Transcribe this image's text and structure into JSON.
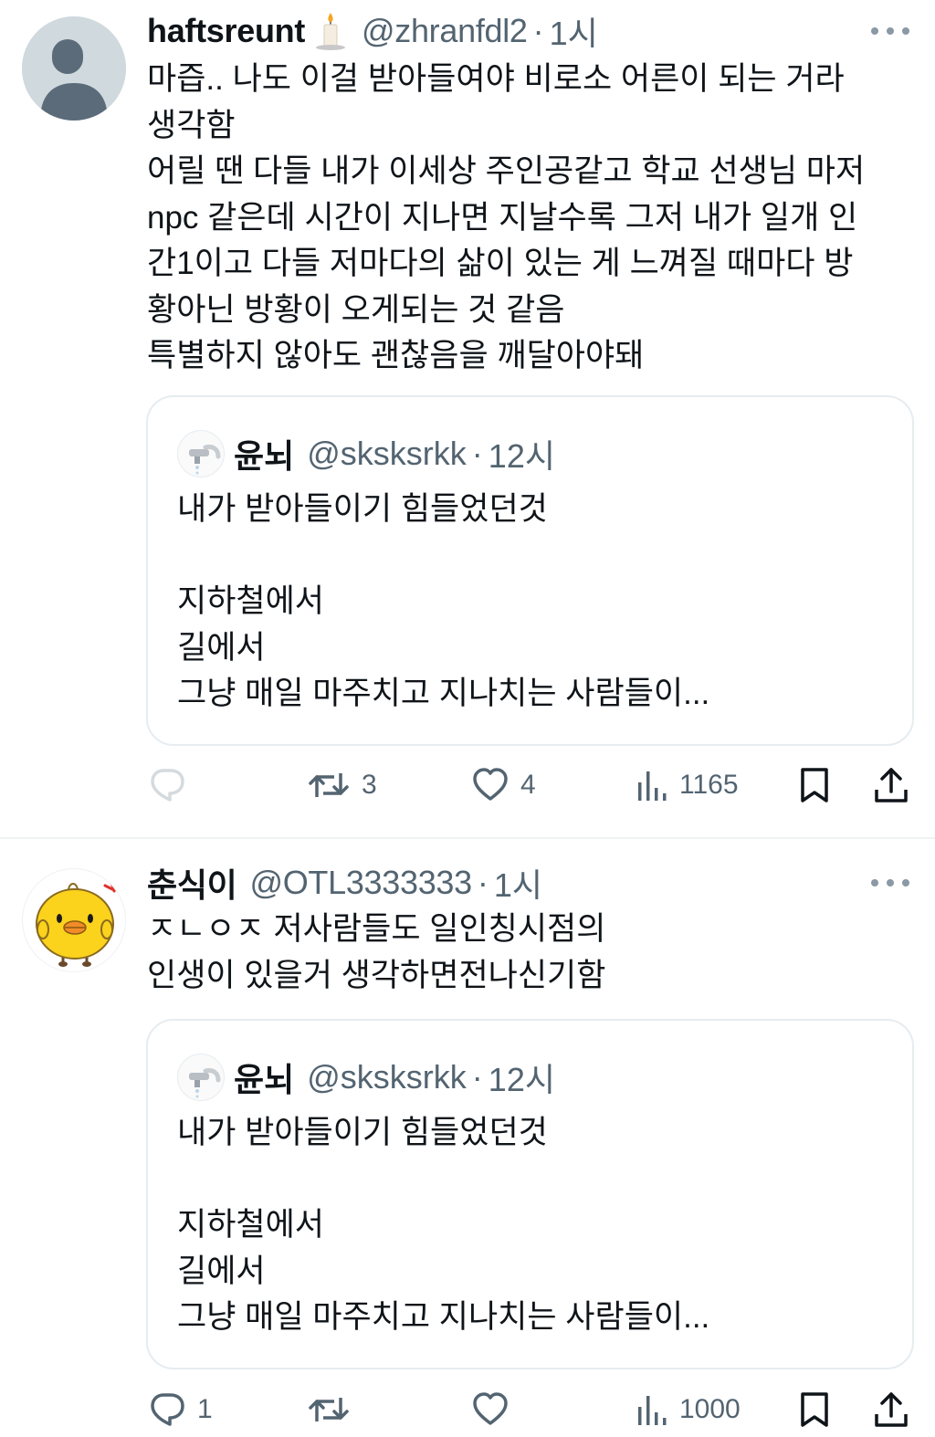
{
  "tweets": [
    {
      "display_name": "haftsreunt",
      "name_emoji": "candle-emoji",
      "handle": "@zhranfdl2",
      "separator": "·",
      "time": "1시",
      "body_lines": [
        "마즙.. 나도 이걸 받아들여야 비로소 어른이 되는 거라",
        "생각함",
        "어릴 땐 다들 내가 이세상 주인공같고 학교 선생님 마저",
        "npc 같은데 시간이 지나면 지날수록 그저 내가 일개 인",
        "간1이고 다들 저마다의 삶이 있는 게 느껴질 때마다 방",
        "황아닌 방황이 오게되는 것 같음",
        "특별하지 않아도 괜찮음을 깨달아야돼"
      ],
      "quote": {
        "display_name": "윤뇌",
        "handle": "@sksksrkk",
        "separator": "·",
        "time": "12시",
        "body_lines": [
          "내가 받아들이기 힘들었던것",
          "",
          "지하철에서",
          "길에서",
          "그냥 매일 마주치고 지나치는 사람들이..."
        ]
      },
      "actions": {
        "reply_count": "",
        "retweet_count": "3",
        "like_count": "4",
        "views_count": "1165"
      }
    },
    {
      "display_name": "춘식이",
      "handle": "@OTL3333333",
      "separator": "·",
      "time": "1시",
      "body_lines": [
        "ㅈㄴㅇㅈ 저사람들도 일인칭시점의",
        "인생이 있을거 생각하면전나신기함"
      ],
      "quote": {
        "display_name": "윤뇌",
        "handle": "@sksksrkk",
        "separator": "·",
        "time": "12시",
        "body_lines": [
          "내가 받아들이기 힘들었던것",
          "",
          "지하철에서",
          "길에서",
          "그냥 매일 마주치고 지나치는 사람들이..."
        ]
      },
      "actions": {
        "reply_count": "1",
        "retweet_count": "",
        "like_count": "",
        "views_count": "1000"
      }
    }
  ],
  "colors": {
    "text_primary": "#0f1419",
    "text_secondary": "#536471",
    "border": "#e6ecf0",
    "default_avatar_bg": "#cfd9de",
    "reply_icon_faded": "#d4dadd"
  }
}
